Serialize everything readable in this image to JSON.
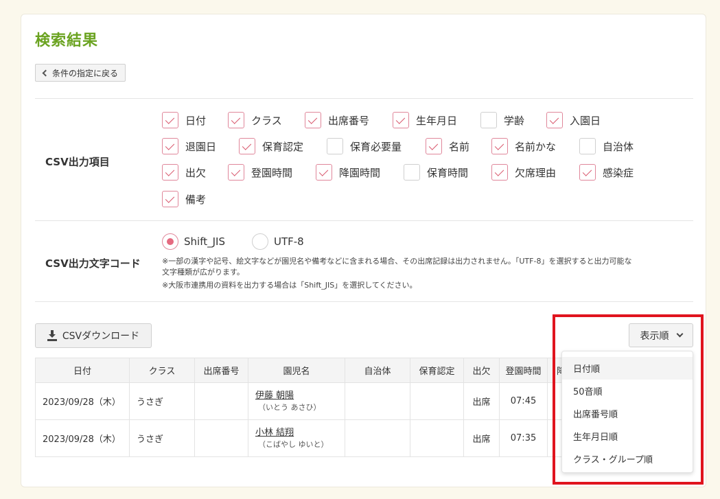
{
  "page": {
    "title": "検索結果",
    "back_label": "条件の指定に戻る"
  },
  "csv_items": {
    "label": "CSV出力項目",
    "items": [
      {
        "label": "日付",
        "checked": true
      },
      {
        "label": "クラス",
        "checked": true
      },
      {
        "label": "出席番号",
        "checked": true
      },
      {
        "label": "生年月日",
        "checked": true
      },
      {
        "label": "学齢",
        "checked": false
      },
      {
        "label": "入園日",
        "checked": true
      },
      {
        "label": "退園日",
        "checked": true
      },
      {
        "label": "保育認定",
        "checked": true
      },
      {
        "label": "保育必要量",
        "checked": false
      },
      {
        "label": "名前",
        "checked": true
      },
      {
        "label": "名前かな",
        "checked": true
      },
      {
        "label": "自治体",
        "checked": false
      },
      {
        "label": "出欠",
        "checked": true
      },
      {
        "label": "登園時間",
        "checked": true
      },
      {
        "label": "降園時間",
        "checked": true
      },
      {
        "label": "保育時間",
        "checked": false
      },
      {
        "label": "欠席理由",
        "checked": true
      },
      {
        "label": "感染症",
        "checked": true
      },
      {
        "label": "備考",
        "checked": true
      }
    ]
  },
  "encoding": {
    "label": "CSV出力文字コード",
    "options": [
      {
        "label": "Shift_JIS",
        "selected": true
      },
      {
        "label": "UTF-8",
        "selected": false
      }
    ],
    "note1": "※一部の漢字や記号、絵文字などが園児名や備考などに含まれる場合、その出席記録は出力されません。「UTF-8」を選択すると出力可能な",
    "note2": "文字種類が広がります。",
    "note3": "※大阪市連携用の資料を出力する場合は「Shift_JIS」を選択してください。"
  },
  "actions": {
    "csv_download": "CSVダウンロード",
    "sort_label": "表示順"
  },
  "table": {
    "headers": [
      "日付",
      "クラス",
      "出席番号",
      "園児名",
      "自治体",
      "保育認定",
      "出欠",
      "登園時間",
      "降"
    ],
    "rows": [
      {
        "date": "2023/09/28（木）",
        "class": "うさぎ",
        "number": "",
        "name": "伊藤 朝陽",
        "kana": "（いとう あさひ）",
        "municipality": "",
        "certification": "",
        "attendance": "出席",
        "arrival": "07:45"
      },
      {
        "date": "2023/09/28（木）",
        "class": "うさぎ",
        "number": "",
        "name": "小林 結翔",
        "kana": "（こばやし ゆいと）",
        "municipality": "",
        "certification": "",
        "attendance": "出席",
        "arrival": "07:35"
      }
    ]
  },
  "sort_menu": {
    "items": [
      "日付順",
      "50音順",
      "出席番号順",
      "生年月日順",
      "クラス・グループ順"
    ],
    "active_index": 0
  },
  "colors": {
    "title": "#6ba321",
    "check": "#d9596f",
    "highlight": "#e0141e",
    "background": "#fbf8ec"
  }
}
